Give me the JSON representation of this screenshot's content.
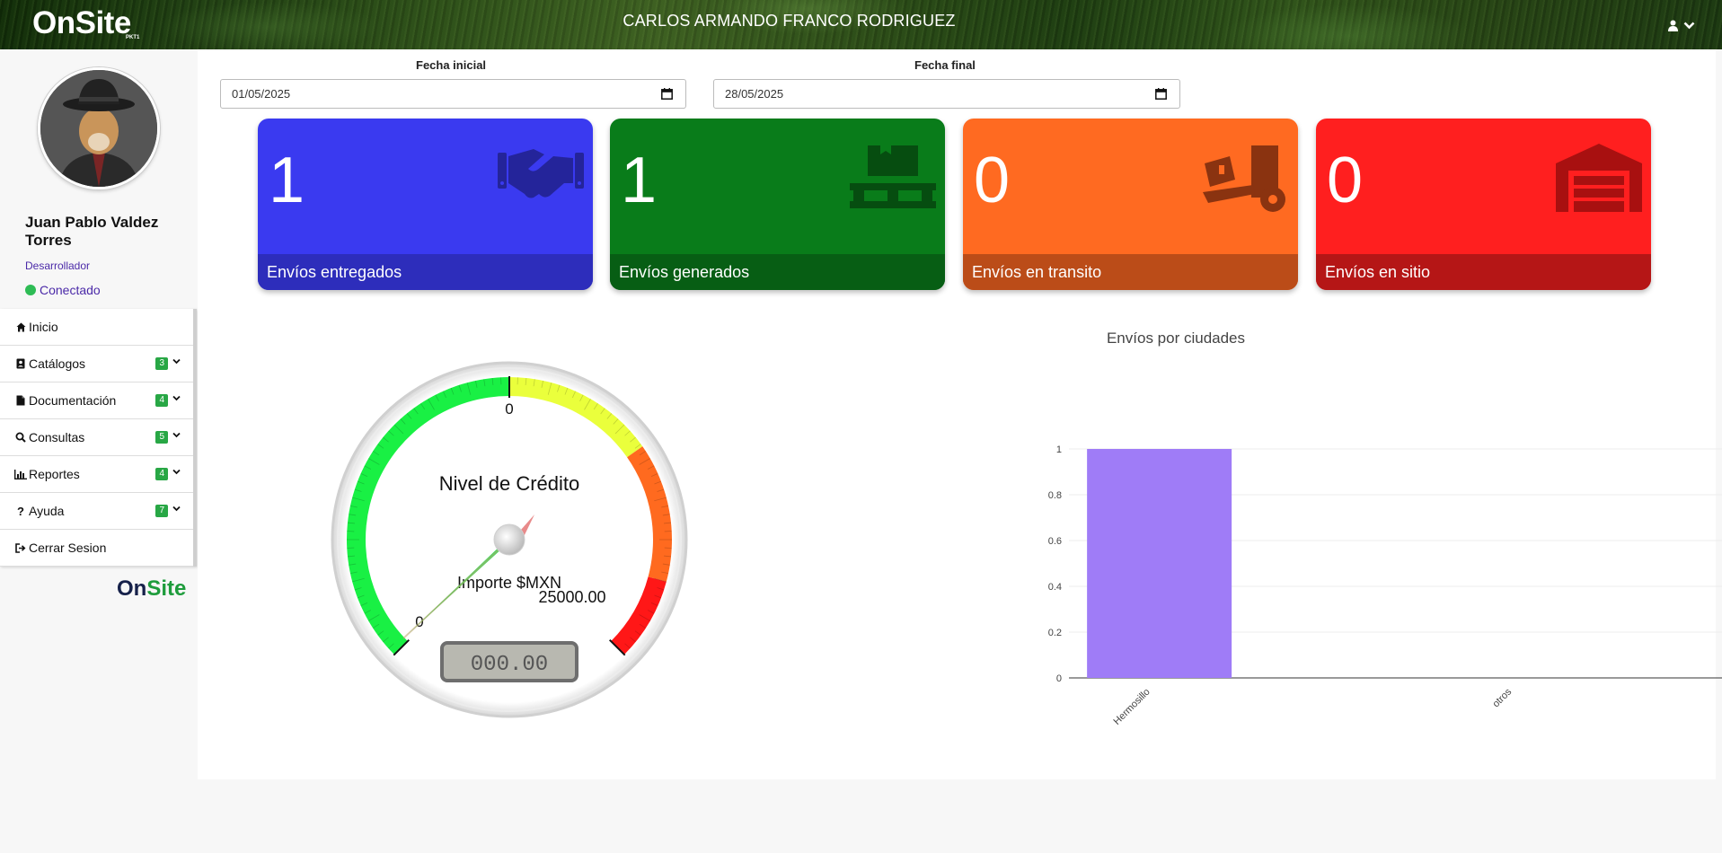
{
  "header": {
    "brand": "OnSite",
    "brand_sub": "PKT1",
    "user_full_name": "CARLOS ARMANDO FRANCO RODRIGUEZ"
  },
  "sidebar": {
    "user_name": "Juan Pablo Valdez Torres",
    "role": "Desarrollador",
    "status": "Conectado",
    "items": [
      {
        "label": "Inicio",
        "icon": "home-icon"
      },
      {
        "label": "Catálogos",
        "icon": "address-card-icon",
        "badge": "3"
      },
      {
        "label": "Documentación",
        "icon": "file-icon",
        "badge": "4"
      },
      {
        "label": "Consultas",
        "icon": "search-icon",
        "badge": "5"
      },
      {
        "label": "Reportes",
        "icon": "bar-chart-icon",
        "badge": "4"
      },
      {
        "label": "Ayuda",
        "icon": "question-icon",
        "badge": "7"
      },
      {
        "label": "Cerrar Sesion",
        "icon": "sign-out-icon"
      }
    ],
    "footer_logo": {
      "on": "On",
      "site": "Site"
    }
  },
  "filters": {
    "start_label": "Fecha inicial",
    "start_value": "01/05/2025",
    "end_label": "Fecha final",
    "end_value": "28/05/2025"
  },
  "cards": [
    {
      "value": "1",
      "label": "Envíos entregados",
      "color": "#3a3af0",
      "foot_color": "#2d2dbb",
      "icon": "handshake-icon"
    },
    {
      "value": "1",
      "label": "Envíos generados",
      "color": "#097c1a",
      "foot_color": "#075e14",
      "icon": "pallet-box-icon"
    },
    {
      "value": "0",
      "label": "Envíos en transito",
      "color": "#ff6a21",
      "foot_color": "#bb4c18",
      "icon": "dolly-icon"
    },
    {
      "value": "0",
      "label": "Envíos en sitio",
      "color": "#ff1f1f",
      "foot_color": "#b51616",
      "icon": "warehouse-icon"
    }
  ],
  "gauge": {
    "title": "Nivel de Crédito",
    "unit": "Importe $MXN",
    "min_label": "0",
    "top_label": "0",
    "max_label": "25000.00",
    "display": "000.00",
    "value": 0
  },
  "chart_data": {
    "type": "bar",
    "title": "Envíos por ciudades",
    "categories": [
      "Hermosillo",
      "otros"
    ],
    "values": [
      1,
      0
    ],
    "ylim": [
      0,
      1
    ],
    "yticks": [
      "0",
      "0.2",
      "0.4",
      "0.6",
      "0.8",
      "1"
    ],
    "bar_color": "#9f7cf7",
    "grid": true
  }
}
